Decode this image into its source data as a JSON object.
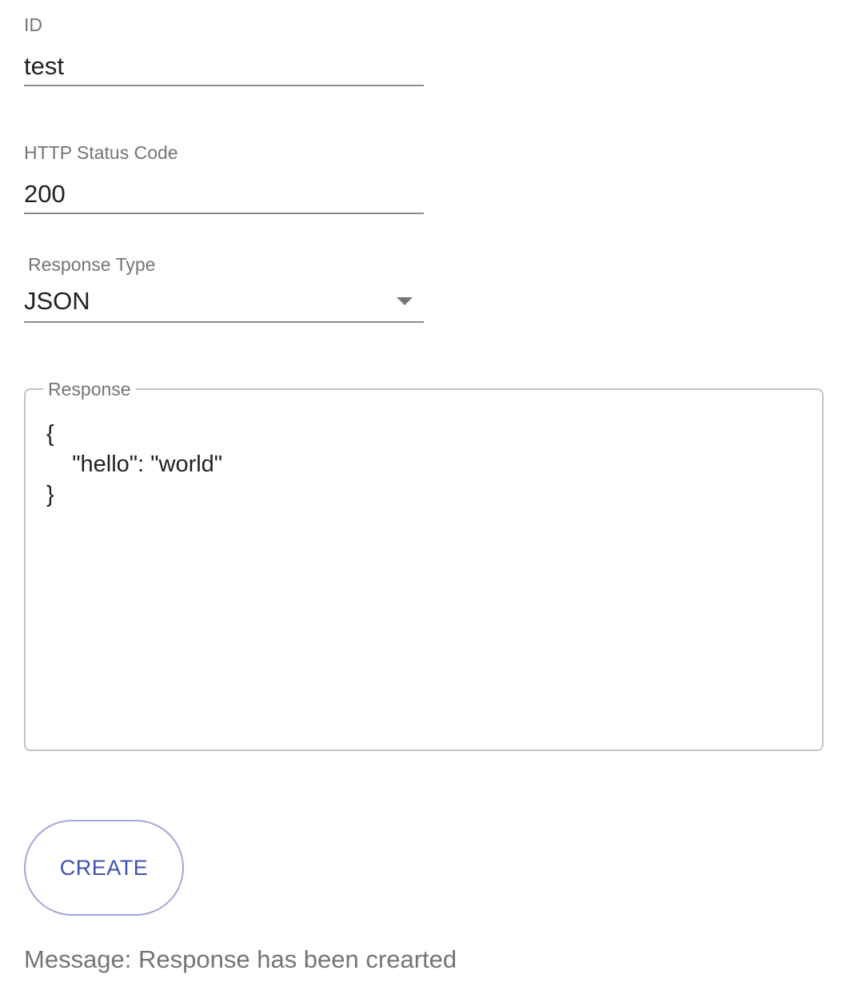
{
  "form": {
    "id": {
      "label": "ID",
      "value": "test"
    },
    "status_code": {
      "label": "HTTP Status Code",
      "value": "200"
    },
    "response_type": {
      "label": "Response Type",
      "selected": "JSON"
    },
    "response": {
      "label": "Response",
      "value": "{\n    \"hello\": \"world\"\n}"
    },
    "create_label": "CREATE"
  },
  "message": "Message: Response has been crearted",
  "colors": {
    "accent": "#3f51b5",
    "muted": "#757575"
  }
}
